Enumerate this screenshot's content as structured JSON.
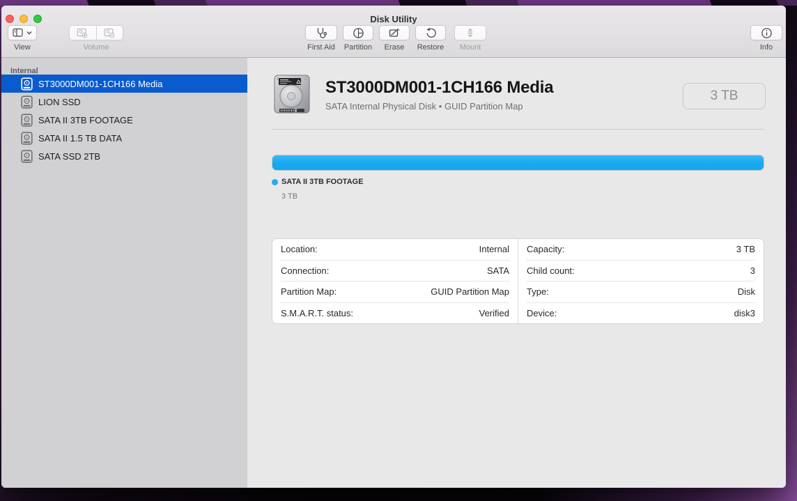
{
  "titlebar": {
    "title": "Disk Utility"
  },
  "toolbar": {
    "view": {
      "label": "View"
    },
    "volume": {
      "label": "Volume"
    },
    "first_aid": {
      "label": "First Aid"
    },
    "partition": {
      "label": "Partition"
    },
    "erase": {
      "label": "Erase"
    },
    "restore": {
      "label": "Restore"
    },
    "mount": {
      "label": "Mount"
    },
    "info": {
      "label": "Info"
    }
  },
  "sidebar": {
    "section_label": "Internal",
    "items": [
      {
        "label": "ST3000DM001-1CH166 Media",
        "selected": true
      },
      {
        "label": "LION SSD",
        "selected": false
      },
      {
        "label": "SATA II 3TB FOOTAGE",
        "selected": false
      },
      {
        "label": "SATA II 1.5 TB DATA",
        "selected": false
      },
      {
        "label": "SATA SSD 2TB",
        "selected": false
      }
    ]
  },
  "main": {
    "title": "ST3000DM001-1CH166 Media",
    "subtitle": "SATA Internal Physical Disk • GUID Partition Map",
    "size_badge": "3 TB",
    "usage": {
      "segments": [
        {
          "label": "SATA II 3TB FOOTAGE",
          "size": "3 TB",
          "color": "#1cadf2",
          "percent": 100
        }
      ]
    },
    "details": {
      "left": [
        {
          "label": "Location:",
          "value": "Internal"
        },
        {
          "label": "Connection:",
          "value": "SATA"
        },
        {
          "label": "Partition Map:",
          "value": "GUID Partition Map"
        },
        {
          "label": "S.M.A.R.T. status:",
          "value": "Verified"
        }
      ],
      "right": [
        {
          "label": "Capacity:",
          "value": "3 TB"
        },
        {
          "label": "Child count:",
          "value": "3"
        },
        {
          "label": "Type:",
          "value": "Disk"
        },
        {
          "label": "Device:",
          "value": "disk3"
        }
      ]
    }
  },
  "colors": {
    "selection_blue": "#0a5bce",
    "usage_bar_blue": "#1cadf2",
    "sidebar_bg": "#d1d0d2",
    "main_bg": "#e9e8e9",
    "traffic_red": "#fc615d",
    "traffic_yellow": "#fdbc40",
    "traffic_green": "#34c749"
  }
}
